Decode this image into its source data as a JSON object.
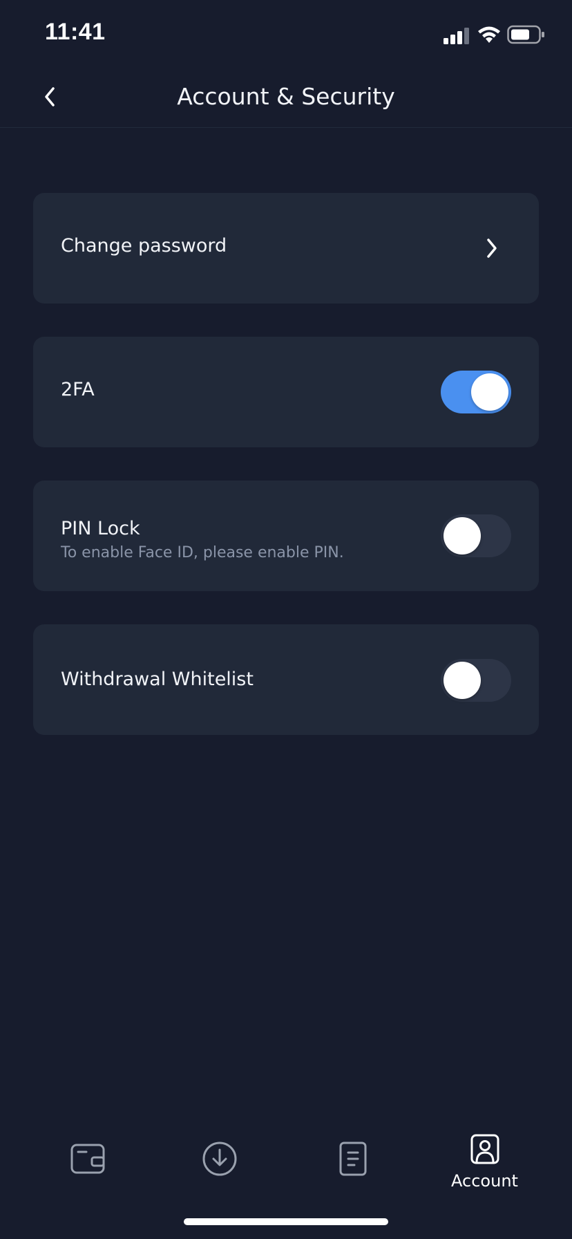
{
  "status_bar": {
    "time": "11:41",
    "icons": [
      "cellular-signal-icon",
      "wifi-icon",
      "battery-icon"
    ]
  },
  "header": {
    "title": "Account & Security",
    "back_icon": "chevron-left-icon"
  },
  "settings": {
    "change_password": {
      "label": "Change password",
      "icon": "chevron-right-icon"
    },
    "two_fa": {
      "label": "2FA",
      "enabled": true
    },
    "pin_lock": {
      "label": "PIN Lock",
      "hint": "To enable Face ID, please enable PIN.",
      "enabled": false
    },
    "withdrawal_whitelist": {
      "label": "Withdrawal Whitelist",
      "enabled": false
    }
  },
  "tab_bar": {
    "items": [
      {
        "icon": "wallet-icon",
        "label": ""
      },
      {
        "icon": "download-icon",
        "label": ""
      },
      {
        "icon": "document-icon",
        "label": ""
      },
      {
        "icon": "account-icon",
        "label": "Account",
        "active": true
      }
    ]
  },
  "colors": {
    "background": "#171c2d",
    "card": "#212939",
    "toggle_on": "#4a90f0",
    "toggle_off": "#2d3547",
    "subtext": "#8a94a8"
  }
}
